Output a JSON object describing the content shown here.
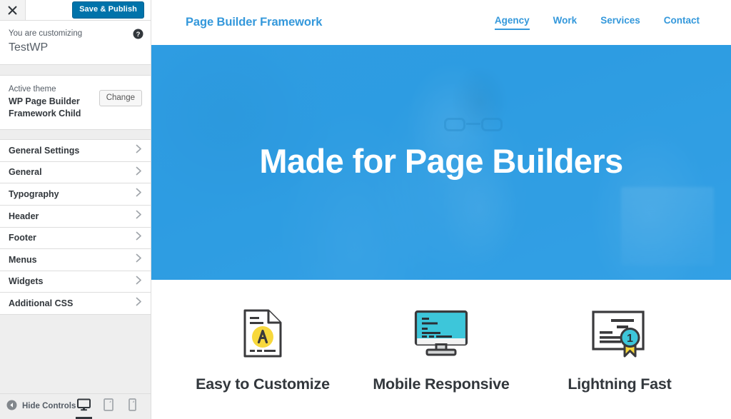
{
  "customizer": {
    "close_icon": "close-icon",
    "save_label": "Save & Publish",
    "help_icon": "help-circle-icon",
    "customizing_label": "You are customizing",
    "site_title": "TestWP",
    "active_theme_label": "Active theme",
    "active_theme_name": "WP Page Builder Framework Child",
    "change_label": "Change",
    "panels": [
      {
        "label": "General Settings"
      },
      {
        "label": "General"
      },
      {
        "label": "Typography"
      },
      {
        "label": "Header"
      },
      {
        "label": "Footer"
      },
      {
        "label": "Menus"
      },
      {
        "label": "Widgets"
      },
      {
        "label": "Additional CSS"
      }
    ],
    "bottom": {
      "hide_controls_label": "Hide Controls",
      "collapse_icon": "collapse-left-icon",
      "devices": [
        {
          "name": "desktop",
          "icon": "desktop-icon",
          "active": true
        },
        {
          "name": "tablet",
          "icon": "tablet-icon",
          "active": false
        },
        {
          "name": "mobile",
          "icon": "mobile-icon",
          "active": false
        }
      ]
    }
  },
  "preview": {
    "brand": "Page Builder Framework",
    "nav": [
      {
        "label": "Agency",
        "active": true
      },
      {
        "label": "Work",
        "active": false
      },
      {
        "label": "Services",
        "active": false
      },
      {
        "label": "Contact",
        "active": false
      }
    ],
    "hero": {
      "title": "Made for Page Builders"
    },
    "features": [
      {
        "title": "Easy to Customize",
        "icon": "document-page-icon"
      },
      {
        "title": "Mobile Responsive",
        "icon": "desktop-monitor-icon"
      },
      {
        "title": "Lightning Fast",
        "icon": "certificate-award-icon"
      }
    ]
  },
  "colors": {
    "wp_blue": "#0073AA",
    "brand_blue": "#3498DB",
    "hero_blue": "#2E9CE2",
    "icon_yellow": "#F7D83C",
    "icon_cyan": "#3DC6DA",
    "icon_dark": "#3A3A3C",
    "heading_dark": "#32373C"
  }
}
